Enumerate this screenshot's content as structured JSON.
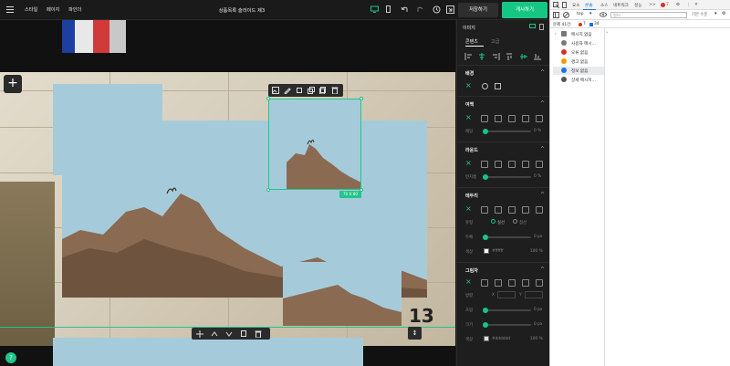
{
  "topbar": {
    "menu_items": [
      "스타일",
      "페이지",
      "파인더"
    ],
    "title": "상품목록 슬라이드 제3",
    "save_label": "저장하기",
    "publish_label": "게시하기"
  },
  "canvas": {
    "selection_size": "70 X 80",
    "calendar_numbers": [
      "13"
    ]
  },
  "panel": {
    "header": "이미지",
    "tabs": [
      "콘텐츠",
      "고급"
    ],
    "sections": {
      "background": "배경",
      "margin": "여백",
      "margin_sub": "패딩",
      "margin_unit": "0 %",
      "rounding": "라운드",
      "rounding_sub": "반지름",
      "rounding_unit": "0 %",
      "border": "테두리",
      "border_type_label": "유형",
      "border_type_solid": "실선",
      "border_type_dashed": "점선",
      "border_width_label": "두께",
      "border_width_unit": "0 px",
      "border_color_label": "색상",
      "border_color_value": "#ffffff",
      "border_color_pct": "100 %",
      "shadow": "그림자",
      "shadow_direction_label": "방향",
      "shadow_x": "X",
      "shadow_y": "Y",
      "shadow_blur_label": "흐림",
      "shadow_blur_unit": "0 px",
      "shadow_size_label": "크기",
      "shadow_size_unit": "0 px",
      "shadow_color_label": "색상",
      "shadow_color_value": "#dddddd",
      "shadow_color_pct": "100 %"
    }
  },
  "devtools": {
    "tabs": [
      "요소",
      "콘솔",
      "소스",
      "네트워크",
      "성능",
      ">>"
    ],
    "error_count": "7",
    "context": "top",
    "filter_placeholder": "필터",
    "level": "기본 수준",
    "issues_label": "문제 41건:",
    "issues_errors": "7",
    "issues_info": "34",
    "sidebar_items": [
      {
        "label": "메시지 없음",
        "icon": "list-icon"
      },
      {
        "label": "사용자 메시...",
        "icon": "user-icon"
      },
      {
        "label": "오류 없음",
        "icon": "error-icon"
      },
      {
        "label": "경고 없음",
        "icon": "warning-icon"
      },
      {
        "label": "정보 없음",
        "icon": "info-icon"
      },
      {
        "label": "상세 메시지...",
        "icon": "bug-icon"
      }
    ]
  },
  "colors": {
    "accent": "#16c784",
    "sky": "#a5cbdb",
    "panel_bg": "#1e1e1e",
    "topbar_bg": "#1a1a1a"
  }
}
